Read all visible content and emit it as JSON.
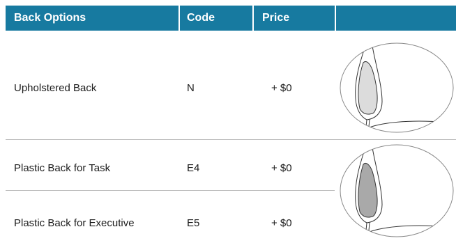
{
  "headers": {
    "back_options": "Back Options",
    "code": "Code",
    "price": "Price",
    "image": ""
  },
  "rows": [
    {
      "option": "Upholstered Back",
      "code": "N",
      "price": "+ $0"
    },
    {
      "option": "Plastic Back for Task",
      "code": "E4",
      "price": "+ $0"
    },
    {
      "option": "Plastic Back for Executive",
      "code": "E5",
      "price": "+ $0"
    }
  ],
  "images": [
    {
      "name": "upholstered-back-illustration",
      "fill": "#dcdcdc"
    },
    {
      "name": "plastic-back-illustration",
      "fill": "#a9a9a9"
    }
  ],
  "colors": {
    "header": "#177aa0",
    "divider": "#b9b9b9"
  }
}
